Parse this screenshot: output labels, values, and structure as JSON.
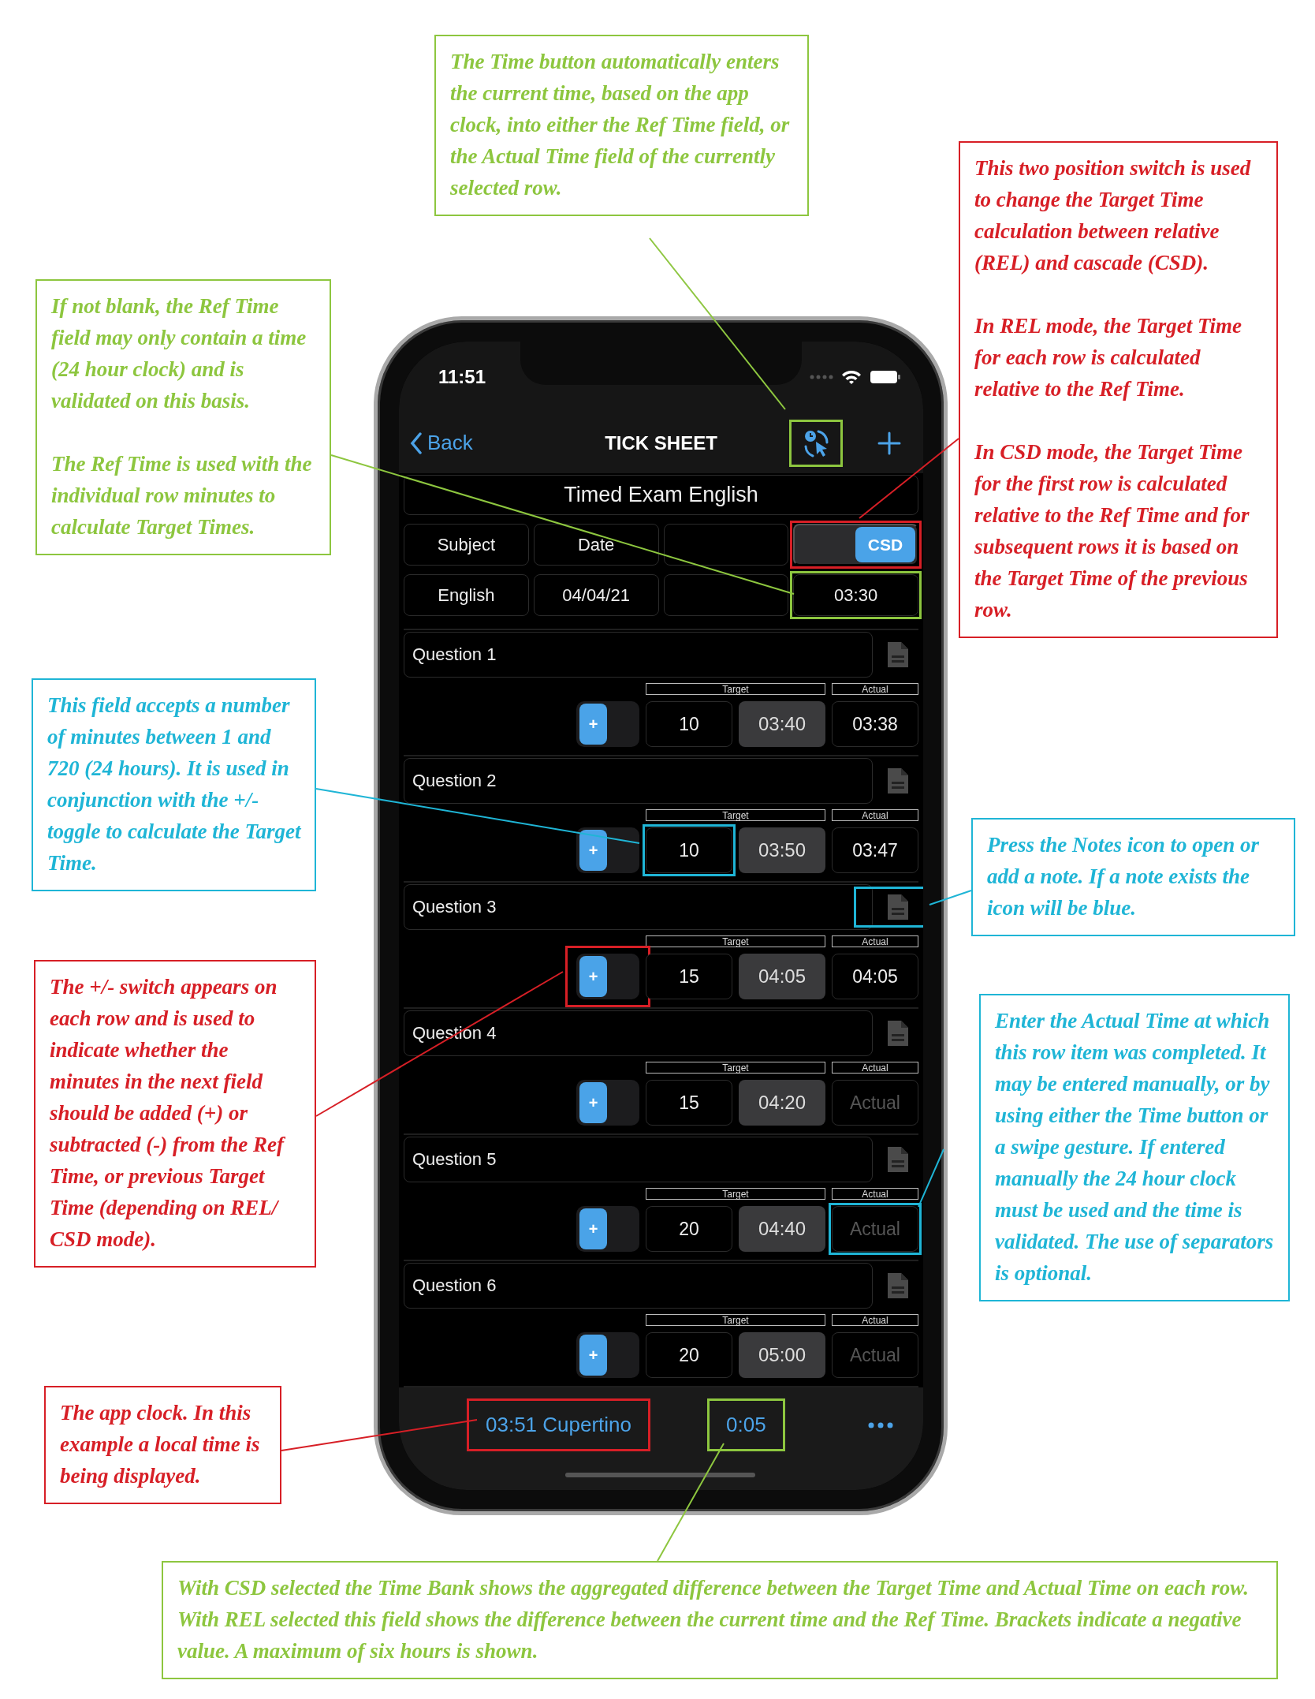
{
  "callouts": [
    {
      "color": "#8dc63f",
      "paragraphs": [
        "The Time button automatically enters the current time, based on the app clock, into either the Ref Time field, or the Actual Time field of the currently selected row."
      ]
    },
    {
      "color": "#d71f26",
      "paragraphs": [
        "This two position switch is used to change the Target Time calculation between relative (REL) and cascade (CSD).",
        "In REL mode, the Target Time for each row is calculated relative to the Ref Time.",
        "In CSD mode, the Target Time for the first row is calculated relative to the Ref Time and for subsequent rows it is based on the Target Time of the previous row."
      ]
    },
    {
      "color": "#8dc63f",
      "paragraphs": [
        "If not blank, the Ref Time field may only contain a time (24 hour clock) and is validated on this basis.",
        "The Ref Time is used with the individual row minutes to calculate Target Times."
      ]
    },
    {
      "color": "#1fb5d6",
      "paragraphs": [
        "This field accepts a number of minutes between 1 and 720 (24 hours). It is used in conjunction with the +/- toggle to calculate the Target Time."
      ]
    },
    {
      "color": "#1fb5d6",
      "paragraphs": [
        "Press the Notes icon to open or add a note. If a note exists the icon will be blue."
      ]
    },
    {
      "color": "#d71f26",
      "paragraphs": [
        "The +/- switch appears on each row and is used to indicate whether the minutes in the next field should be added (+) or subtracted (-) from the Ref Time, or previous Target Time (depending on REL/ CSD mode)."
      ]
    },
    {
      "color": "#1fb5d6",
      "paragraphs": [
        "Enter the Actual Time at which this row item was completed. It may be entered manually, or by using either the Time button or a swipe gesture. If entered manually the 24 hour clock must be used and the time is validated. The use of separators is optional."
      ]
    },
    {
      "color": "#d71f26",
      "paragraphs": [
        "The app clock. In this example a local time is being displayed."
      ]
    },
    {
      "color": "#8dc63f",
      "paragraphs": [
        "With CSD selected the Time Bank shows the aggregated difference between the Target Time and Actual Time on each row. With REL selected this field shows the difference between the current time and the Ref Time. Brackets indicate a negative value. A maximum of six hours is shown."
      ]
    }
  ],
  "status_bar": {
    "time": "11:51"
  },
  "nav_bar": {
    "back": "Back",
    "title": "TICK SHEET",
    "time_button_frame": {
      "color": "#8dc63f"
    }
  },
  "sheet": {
    "title": "Timed Exam English",
    "subject_label": "Subject",
    "date_label": "Date",
    "mode_toggle": {
      "label": "CSD",
      "on": true,
      "frame": {
        "color": "#d71f26"
      }
    },
    "subject": "English",
    "date": "04/04/21",
    "ref_time": {
      "value": "03:30",
      "frame": {
        "color": "#8dc63f"
      }
    }
  },
  "rows": [
    {
      "question": "Question 1",
      "target_header": "Target",
      "actual_header": "Actual",
      "sign": "+",
      "on": true,
      "minutes": "10",
      "target": "03:40",
      "actual": "03:38"
    },
    {
      "question": "Question 2",
      "target_header": "Target",
      "actual_header": "Actual",
      "sign": "+",
      "on": true,
      "minutes": "10",
      "target": "03:50",
      "actual": "03:47",
      "minutes_frame": {
        "color": "#1fb5d6"
      }
    },
    {
      "question": "Question 3",
      "target_header": "Target",
      "actual_header": "Actual",
      "sign": "+",
      "on": true,
      "minutes": "15",
      "target": "04:05",
      "actual": "04:05",
      "notes_frame": {
        "color": "#1fb5d6"
      },
      "switch_frame": {
        "color": "#d71f26"
      }
    },
    {
      "question": "Question 4",
      "target_header": "Target",
      "actual_header": "Actual",
      "sign": "+",
      "on": true,
      "minutes": "15",
      "target": "04:20",
      "actual_placeholder": "Actual"
    },
    {
      "question": "Question 5",
      "target_header": "Target",
      "actual_header": "Actual",
      "sign": "+",
      "on": true,
      "minutes": "20",
      "target": "04:40",
      "actual_placeholder": "Actual",
      "actual_frame": {
        "color": "#1fb5d6"
      }
    },
    {
      "question": "Question 6",
      "target_header": "Target",
      "actual_header": "Actual",
      "sign": "+",
      "on": true,
      "minutes": "20",
      "target": "05:00",
      "actual_placeholder": "Actual"
    }
  ],
  "toolbar": {
    "clock": {
      "text": "03:51 Cupertino",
      "frame": {
        "color": "#d71f26"
      }
    },
    "time_bank": {
      "text": "0:05",
      "frame": {
        "color": "#8dc63f"
      }
    }
  }
}
